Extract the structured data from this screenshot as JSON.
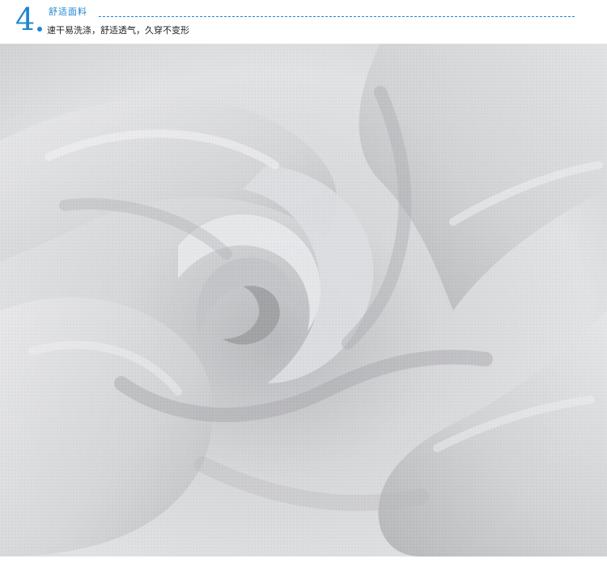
{
  "header": {
    "number": "4",
    "title": "舒适面料",
    "subtitle": "速干易洗涤，舒适透气，久穿不变形"
  },
  "photo": {
    "subject": "fabric-swirl-image"
  },
  "colors": {
    "accent": "#1f86d4",
    "fabric_light": "#e4e5e7",
    "fabric_mid": "#c9cacc",
    "fabric_dark": "#a9aaad"
  }
}
